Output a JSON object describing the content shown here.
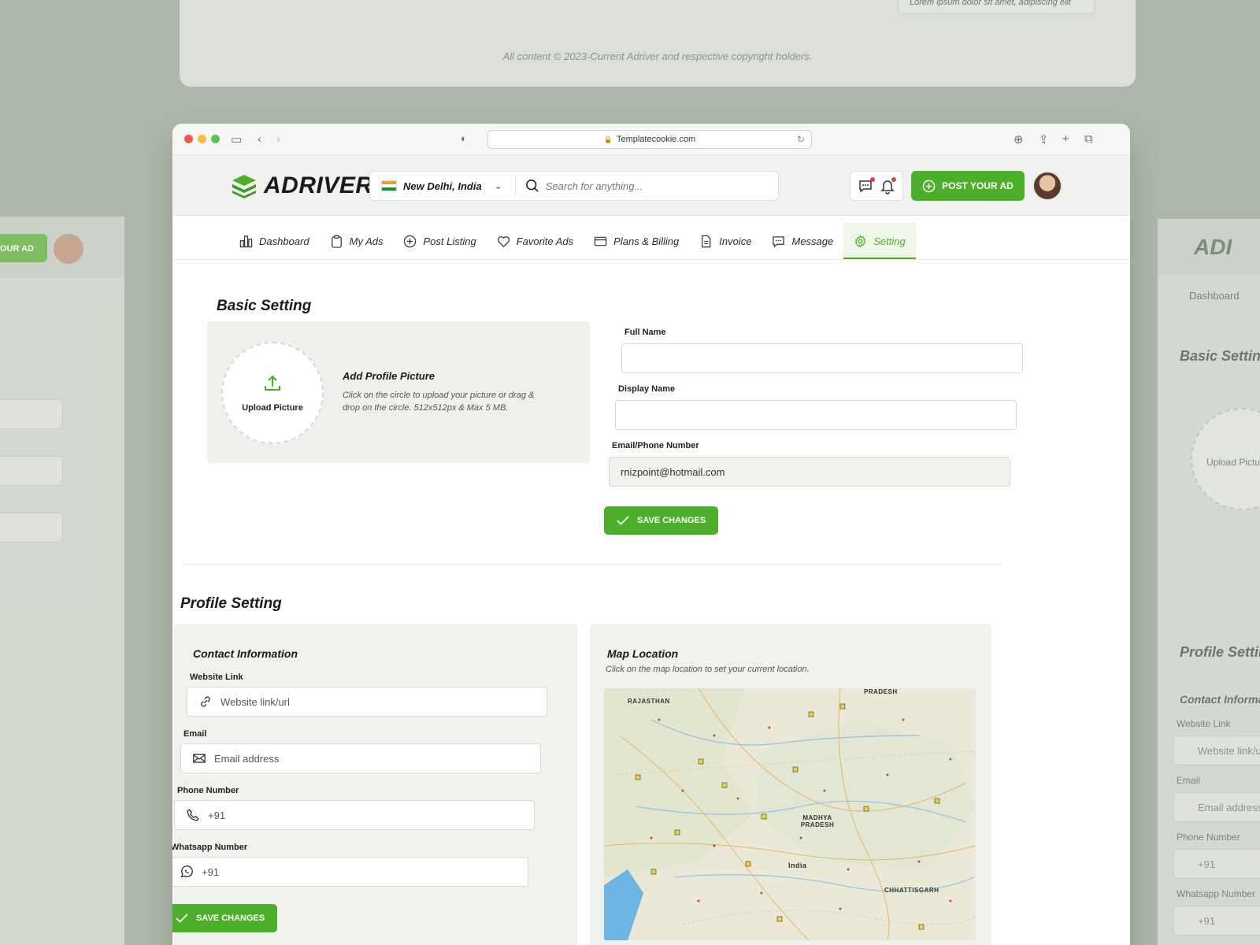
{
  "background": {
    "top_footer": "All content © 2023-Current Adriver and respective copyright holders.",
    "top_note": "Lorem ipsum dolor sit amet, adipiscing elit",
    "left_button": "OUR AD",
    "right_logo": "ADI",
    "right_nav": "Dashboard",
    "right_basic": "Basic Settin",
    "right_upload": "Upload Pictu",
    "right_profile": "Profile Setting",
    "right_contact": "Contact Informatio",
    "right_website_label": "Website Link",
    "right_website_ph": "Website link/url",
    "right_email_label": "Email",
    "right_email_ph": "Email address",
    "right_phone_label": "Phone Number",
    "right_phone_ph": "+91",
    "right_whatsapp_label": "Whatsapp Number",
    "right_whatsapp_ph": "+91"
  },
  "browser": {
    "url": "Templatecookie.com"
  },
  "header": {
    "logo": "ADRIVER",
    "location": "New Delhi, India",
    "search_placeholder": "Search for anything...",
    "post_button": "POST YOUR AD"
  },
  "nav": {
    "items": [
      {
        "label": "Dashboard",
        "icon": "dashboard-icon"
      },
      {
        "label": "My Ads",
        "icon": "clipboard-icon"
      },
      {
        "label": "Post Listing",
        "icon": "plus-circle-icon"
      },
      {
        "label": "Favorite Ads",
        "icon": "heart-icon"
      },
      {
        "label": "Plans & Billing",
        "icon": "credit-card-icon"
      },
      {
        "label": "Invoice",
        "icon": "document-icon"
      },
      {
        "label": "Message",
        "icon": "chat-icon"
      },
      {
        "label": "Setting",
        "icon": "gear-icon"
      }
    ],
    "active": "Setting"
  },
  "basic": {
    "title": "Basic Setting",
    "upload_label": "Upload Picture",
    "add_title": "Add Profile Picture",
    "add_desc": "Click on the circle to upload your picture or drag & drop on the circle. 512x512px & Max 5 MB.",
    "full_name_label": "Full Name",
    "full_name_value": "",
    "display_name_label": "Display Name",
    "display_name_value": "",
    "email_label": "Email/Phone Number",
    "email_value": "rnizpoint@hotmail.com",
    "save": "SAVE CHANGES"
  },
  "profile": {
    "title": "Profile Setting",
    "contact_title": "Contact Information",
    "website_label": "Website Link",
    "website_placeholder": "Website link/url",
    "email_label": "Email",
    "email_placeholder": "Email address",
    "phone_label": "Phone Number",
    "phone_placeholder": "+91",
    "whatsapp_label": "Whatsapp Number",
    "whatsapp_placeholder": "+91",
    "save": "SAVE CHANGES",
    "map_title": "Map Location",
    "map_note": "Click on the map location to set your current location.",
    "map_labels": [
      "RAJASTHAN",
      "MADHYA PRADESH",
      "India",
      "CHHATTISGARH",
      "PRADESH"
    ]
  },
  "colors": {
    "accent": "#4caf2a",
    "background": "#adb8aa"
  }
}
